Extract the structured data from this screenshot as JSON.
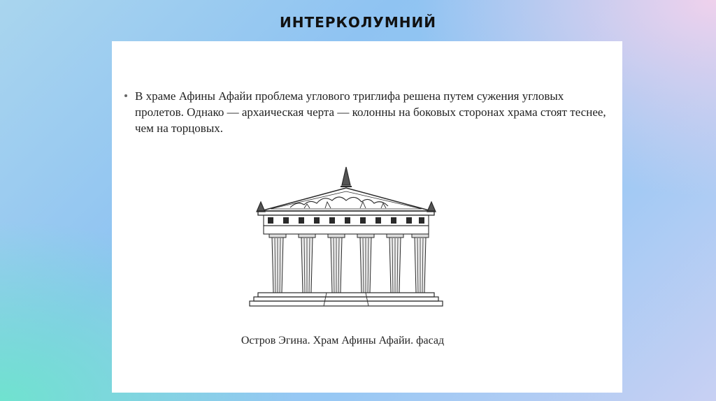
{
  "slide": {
    "title": "ИНТЕРКОЛУМНИЙ"
  },
  "content": {
    "bullet_text": "В храме Афины Афайи проблема углового триглифа решена путем сужения угловых пролетов. Однако — архаическая черта — колонны на боковых сторонах храма стоят теснее, чем на торцовых.",
    "figure": {
      "icon": "greek-temple-facade-illustration",
      "caption": "Остров Эгина. Храм Афины Афайи. фасад"
    }
  },
  "colors": {
    "panel_background": "#ffffff",
    "text": "#222222",
    "drawing_ink": "#2a2a2a"
  }
}
